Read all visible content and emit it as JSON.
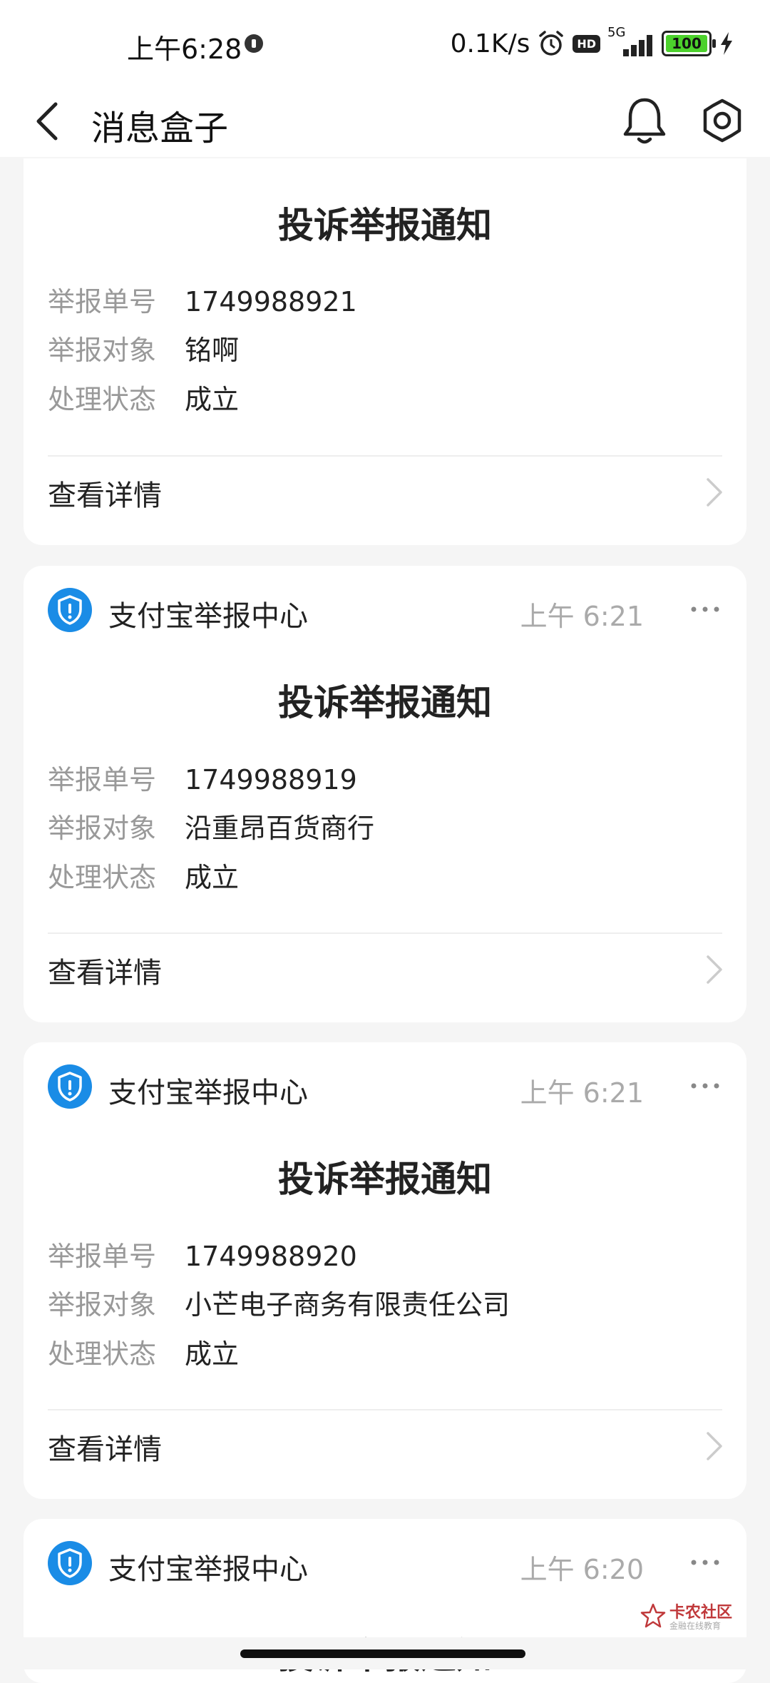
{
  "status_bar": {
    "time": "上午6:28",
    "net_speed": "0.1K/s",
    "hd": "HD",
    "network": "5G",
    "battery": "100"
  },
  "navbar": {
    "title": "消息盒子"
  },
  "labels": {
    "report_no": "举报单号",
    "report_target": "举报对象",
    "status": "处理状态",
    "view_details": "查看详情"
  },
  "messages": [
    {
      "sender": "",
      "time": "",
      "title": "投诉举报通知",
      "report_no": "1749988921",
      "report_target": "铭啊",
      "status": "成立"
    },
    {
      "sender": "支付宝举报中心",
      "time": "上午 6:21",
      "title": "投诉举报通知",
      "report_no": "1749988919",
      "report_target": "沿重昂百货商行",
      "status": "成立"
    },
    {
      "sender": "支付宝举报中心",
      "time": "上午 6:21",
      "title": "投诉举报通知",
      "report_no": "1749988920",
      "report_target": "小芒电子商务有限责任公司",
      "status": "成立"
    },
    {
      "sender": "支付宝举报中心",
      "time": "上午 6:20",
      "title": "投诉举报通知"
    }
  ],
  "watermark": {
    "brand": "卡农社区",
    "tagline": "金融在线教育"
  },
  "colors": {
    "accent_blue": "#1a8ce6",
    "background": "#f5f5f5",
    "battery_green": "#4cd12c"
  }
}
